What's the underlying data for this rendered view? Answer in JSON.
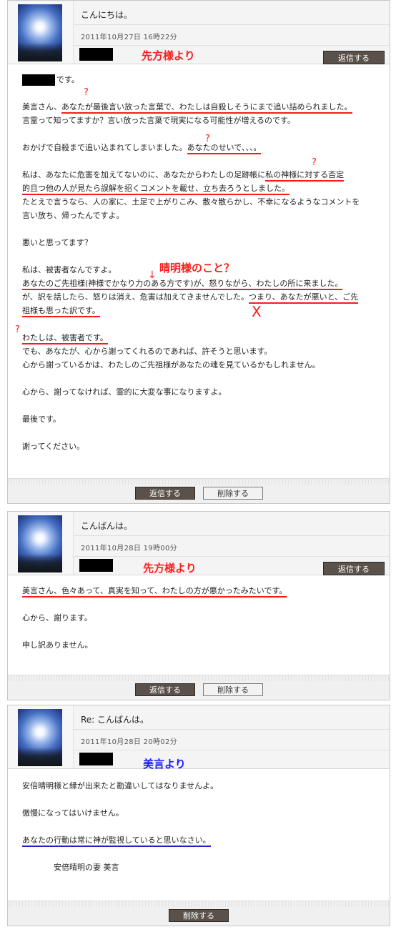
{
  "colors": {
    "annotation_red": "#ff1d1d",
    "annotation_blue": "#1a1aff",
    "button_dark": "#5a514a"
  },
  "icons": {
    "avatar": "sun-sky-photo"
  },
  "messages": [
    {
      "subject": "こんにちは。",
      "date": "2011年10月27日  16時22分",
      "annotation": "先方様より",
      "reply_label": "返信する",
      "lines": {
        "l1": "です。",
        "l2a": "美言さん、",
        "l2b": "あなたが最後言い放った言葉で、わたしは自殺しそうにまで追い詰められました。",
        "l3": "言霊って知ってますか？言い放った言葉で現実になる可能性が増えるのです。",
        "l4a": "おかげで自殺まで追い込まれてしまいました。",
        "l4b": "あなたのせいで、、、。",
        "l5a": "私は、あなたに危害を加えてないのに、あなたからわたしの足跡帳に",
        "l5b": "私の神様に対する否定",
        "l6": "的且つ他の人が見たら誤解を招くコメントを載せ、立ち去ろうとしました。",
        "l7": "たとえで言うなら、人の家に、土足で上がりこみ、散々散らかし、不幸になるようなコメントを",
        "l8": "言い放ち、帰ったんですよ。",
        "l9": "悪いと思ってます？",
        "l10": "私は、被害者なんですよ。",
        "l11": "あなたのご先祖様(神様でかなり力のある方です)が、怒りながら、わたしの所に来ました。",
        "l12a": "が、訳を話したら、怒りは消え、危害は加えてきませんでした。",
        "l12b": "つまり、あなたが悪いと、ご先",
        "l13": "祖様も思った訳です。",
        "l14": "わたしは、被害者です。",
        "l15": "でも、あなたが、心から謝ってくれるのであれば、許そうと思います。",
        "l16": "心から謝っているかは、わたしのご先祖様があなたの魂を見ているかもしれません。",
        "l17": "心から、謝ってなければ、霊的に大変な事になりますよ。",
        "l18": "最後です。",
        "l19": "謝ってください。"
      },
      "notes": {
        "q": "?",
        "seimei": "晴明様のこと？",
        "x": "X"
      },
      "footer": {
        "reply": "返信する",
        "delete": "削除する"
      }
    },
    {
      "subject": "こんばんは。",
      "date": "2011年10月28日  19時00分",
      "annotation": "先方様より",
      "reply_label": "返信する",
      "lines": {
        "l1": "美言さん、色々あって、真実を知って、わたしの方が悪かったみたいです。",
        "l2": "心から、謝ります。",
        "l3": "申し訳ありません。"
      },
      "footer": {
        "reply": "返信する",
        "delete": "削除する"
      }
    },
    {
      "subject": "Re: こんばんは。",
      "date": "2011年10月28日  20時02分",
      "annotation": "美言より",
      "lines": {
        "l1": "安倍晴明様と縁が出来たと勘違いしてはなりませんよ。",
        "l2": "傲慢になってはいけません。",
        "l3": "あなたの行動は常に神が監視していると思いなさい。",
        "l4": "安倍晴明の妻  美言"
      },
      "footer": {
        "delete": "削除する"
      }
    }
  ]
}
